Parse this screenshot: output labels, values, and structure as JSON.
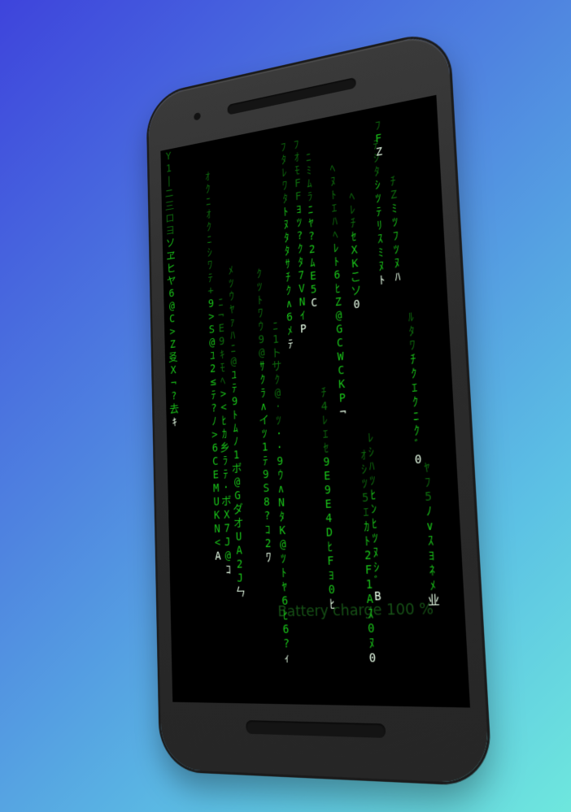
{
  "wallpaper": {
    "battery_text": "Battery charge 100 %"
  },
  "colors": {
    "rain": "#19c419",
    "rain_head": "#e8ffe8",
    "screen": "#000000",
    "background_start": "#3e44dc",
    "background_end": "#6ee7dd"
  },
  "rain_columns": [
    {
      "id": "c01",
      "chars": "Y1|ニ三ロヨソヱヒヤ6@C>Z㕛X¬?去ｷ"
    },
    {
      "id": "c02",
      "chars": "ｵｸﾆｵｸﾆｼﾜﾃ+9>S@ﾕ2≤ﾃ?ﾉ>6CEMUKN<A"
    },
    {
      "id": "c03",
      "chars": "ﾒﾂｳﾔｧﾊﾆ@ﾕﾃ9ﾄﾑﾉ1ボ@GダオUA2Jㄣ"
    },
    {
      "id": "c04",
      "chars": "ﾆ¬E9ｷﾓﾍ><ﾋｶ乡ﾗﾃ·ボX7J@ｺ"
    },
    {
      "id": "c05",
      "chars": "ｸﾂﾄﾜｳ9@ｻｸﾗ∧イﾂ1ﾃ9S8?ｺ2ﾜ"
    },
    {
      "id": "c06",
      "chars": "ﾆ1トサｸ@·ﾂ··9ｳ∧NﾀK@ﾂﾄﾔ6ﾋ6?ｨ"
    },
    {
      "id": "c07",
      "chars": "ﾌﾀﾚﾜﾀﾄﾇﾀﾀｻﾁｸ∧6ﾒﾃ"
    },
    {
      "id": "c08",
      "chars": "ﾌｵﾓFFﾖﾂ?ｸﾀ7VNｲP"
    },
    {
      "id": "c09",
      "chars": "ﾆﾐﾑﾗﾆﾔ?2ﾑE5C"
    },
    {
      "id": "c10",
      "chars": "ﾁ4ﾚｴｾ9E9E4DﾋFﾖ0ﾋ"
    },
    {
      "id": "c11",
      "chars": "ﾍﾇﾄｴﾊﾍﾚﾄ6ﾋZ@GCWCKP¬"
    },
    {
      "id": "c12",
      "chars": "ﾍﾚﾁｾXKこソ0"
    },
    {
      "id": "c13",
      "chars": "ｵｼﾂ5ｴｶﾄ2F1Aｽ0ﾇ0"
    },
    {
      "id": "c14",
      "chars": "ﾚｼﾊﾂﾋﾝﾋﾂﾇｼﾞB"
    },
    {
      "id": "c15",
      "chars": "ﾃｼﾀｼﾂﾃﾘｽﾐﾇﾄ"
    },
    {
      "id": "c16",
      "chars": "ﾁZﾐﾂﾌﾂﾇﾊ"
    },
    {
      "id": "c17",
      "chars": "ﾌFZ"
    },
    {
      "id": "c18",
      "chars": "ﾙﾀﾜﾁｸｴｸﾆｸﾞ0"
    },
    {
      "id": "c19",
      "chars": "ﾔﾌ5ﾉ∨ｽﾖﾈﾒ业"
    }
  ]
}
